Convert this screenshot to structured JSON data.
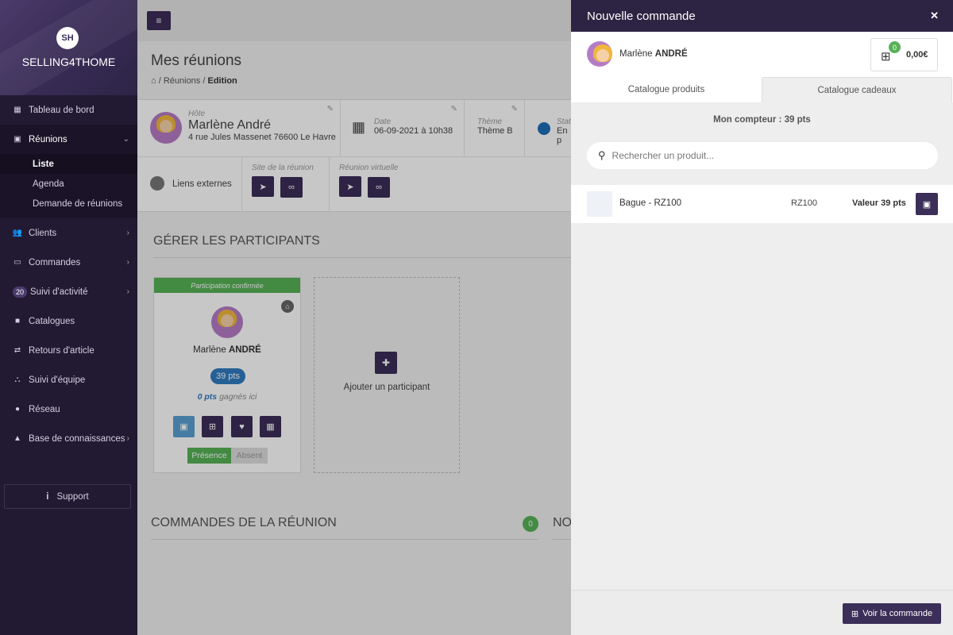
{
  "brand": {
    "logo": "SH",
    "name": "SELLING4THOME"
  },
  "sidebar": {
    "items": [
      {
        "label": "Tableau de bord",
        "icon": "dashboard-icon"
      },
      {
        "label": "Réunions",
        "icon": "calendar-icon"
      },
      {
        "label": "Clients",
        "icon": "users-icon"
      },
      {
        "label": "Commandes",
        "icon": "card-icon"
      },
      {
        "label": "Suivi d'activité",
        "badge": "20"
      },
      {
        "label": "Catalogues",
        "icon": "book-icon"
      },
      {
        "label": "Retours d'article",
        "icon": "exchange-icon"
      },
      {
        "label": "Suivi d'équipe",
        "icon": "sitemap-icon"
      },
      {
        "label": "Réseau",
        "icon": "globe-icon"
      },
      {
        "label": "Base de connaissances",
        "icon": "graduation-cap-icon"
      }
    ],
    "sub_items": [
      "Liste",
      "Agenda",
      "Demande de réunions"
    ],
    "support": "Support"
  },
  "main": {
    "title": "Mes réunions",
    "breadcrumb": {
      "level1": "Réunions",
      "current": "Edition"
    },
    "host": {
      "label": "Hôte",
      "name": "Marlène André",
      "address": "4 rue Jules Massenet 76600 Le Havre"
    },
    "date": {
      "label": "Date",
      "value": "06-09-2021 à 10h38"
    },
    "theme": {
      "label": "Thème",
      "value": "Thème B"
    },
    "status": {
      "label": "Stat",
      "value": "En p"
    },
    "links": {
      "label": "Liens externes",
      "site_label": "Site de la réunion",
      "virtual_label": "Réunion virtuelle"
    },
    "participants_title": "GÉRER LES PARTICIPANTS",
    "participant": {
      "status": "Participation confirmée",
      "first_name": "Marlène",
      "last_name": "ANDRÉ",
      "points": "39 pts",
      "earned_value": "0 pts",
      "earned_suffix": "gagnés ici",
      "presence": "Présence",
      "absent": "Absent"
    },
    "add_participant": "Ajouter un participant",
    "orders_title": "COMMANDES DE LA RÉUNION",
    "orders_count": "0",
    "next_section_title": "NO"
  },
  "panel": {
    "title": "Nouvelle commande",
    "client_first": "Marlène",
    "client_last": "ANDRÉ",
    "cart_count": "0",
    "cart_amount": "0,00€",
    "tabs": [
      "Catalogue produits",
      "Catalogue cadeaux"
    ],
    "counter": "Mon compteur : 39 pts",
    "search_placeholder": "Rechercher un produit...",
    "product": {
      "name": "Bague - RZ100",
      "ref": "RZ100",
      "value": "Valeur 39 pts"
    },
    "view_order": "Voir la commande"
  },
  "colors": {
    "primary": "#3b2e58",
    "sidebar": "#221a32",
    "success": "#57b157",
    "info": "#2f7cc0"
  }
}
